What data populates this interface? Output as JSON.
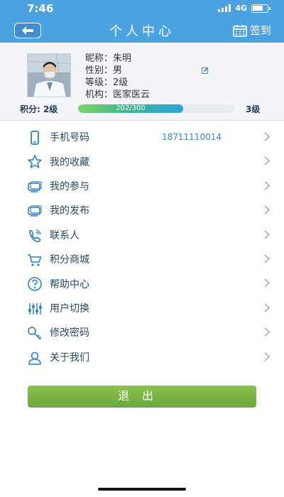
{
  "status_bar": {
    "time": "7:46",
    "network": "4G"
  },
  "header": {
    "title": "个人中心",
    "checkin_label": "签到"
  },
  "profile": {
    "nickname_label": "昵称：",
    "nickname": "朱明",
    "gender_label": "性别：",
    "gender": "男",
    "level_label": "等级：",
    "level": "2级",
    "org_label": "机构：",
    "org": "医家医云"
  },
  "points": {
    "label": "积分: 2级",
    "progress_text": "202/300",
    "progress_fraction": 0.673,
    "next_level": "3级"
  },
  "menu": [
    {
      "label": "手机号码",
      "value": "18711110014",
      "icon": "phone-icon"
    },
    {
      "label": "我的收藏",
      "icon": "star-icon"
    },
    {
      "label": "我的参与",
      "icon": "participation-icon"
    },
    {
      "label": "我的发布",
      "icon": "publish-icon"
    },
    {
      "label": "联系人",
      "icon": "contact-phone-icon"
    },
    {
      "label": "积分商城",
      "icon": "cart-icon"
    },
    {
      "label": "帮助中心",
      "icon": "help-icon"
    },
    {
      "label": "用户切换",
      "icon": "switch-user-icon"
    },
    {
      "label": "修改密码",
      "icon": "key-icon"
    },
    {
      "label": "关于我们",
      "icon": "about-icon"
    }
  ],
  "logout_label": "退出",
  "colors": {
    "header": "#4aa2e0",
    "menu_text": "#264a6a",
    "logout": "#78b442"
  }
}
